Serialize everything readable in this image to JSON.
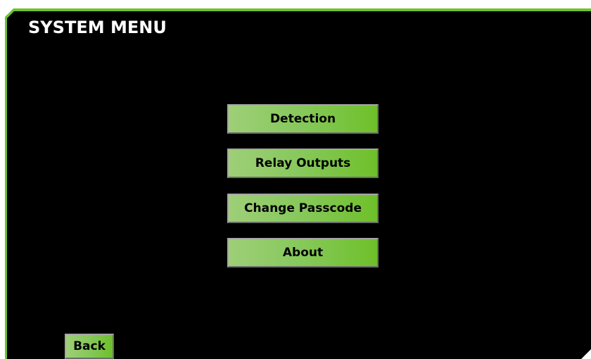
{
  "screen": {
    "title": "SYSTEM MENU"
  },
  "menu": {
    "items": [
      {
        "label": "Detection"
      },
      {
        "label": "Relay Outputs"
      },
      {
        "label": "Change Passcode"
      },
      {
        "label": "About"
      }
    ]
  },
  "footer": {
    "back_label": "Back"
  },
  "colors": {
    "frame_accent": "#6fc230",
    "background": "#000000",
    "button_gradient_start": "#9ecf78",
    "button_gradient_end": "#6ec02a",
    "title_text": "#ffffff"
  }
}
